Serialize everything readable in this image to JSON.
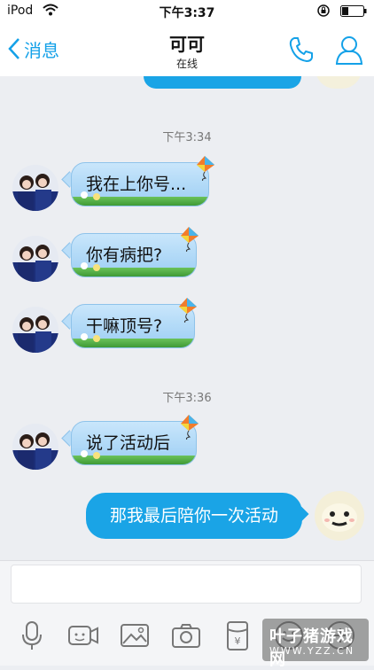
{
  "status_bar": {
    "carrier": "iPod",
    "time": "下午3:37"
  },
  "nav": {
    "back_label": "消息",
    "title": "可可",
    "subtitle": "在线"
  },
  "messages": [
    {
      "type": "timestamp",
      "text": "下午3:34"
    },
    {
      "type": "incoming",
      "text": "我在上你号..."
    },
    {
      "type": "incoming",
      "text": "你有病把?"
    },
    {
      "type": "incoming",
      "text": "干嘛顶号?"
    },
    {
      "type": "timestamp",
      "text": "下午3:36"
    },
    {
      "type": "incoming",
      "text": "说了活动后"
    },
    {
      "type": "outgoing",
      "text": "那我最后陪你一次活动"
    }
  ],
  "input": {
    "value": "",
    "placeholder": ""
  },
  "toolbar": {
    "icons": [
      "microphone-icon",
      "video-icon",
      "image-icon",
      "camera-icon",
      "red-packet-icon",
      "emoji-icon",
      "plus-icon"
    ]
  },
  "watermark": {
    "main": "叶子猪游戏网",
    "sub": "WWW.YZZ.CN"
  },
  "colors": {
    "accent": "#14a1e8",
    "outgoing_bubble": "#1aa4e6",
    "incoming_bubble": "#b3dbf8",
    "background": "#eceef2"
  }
}
